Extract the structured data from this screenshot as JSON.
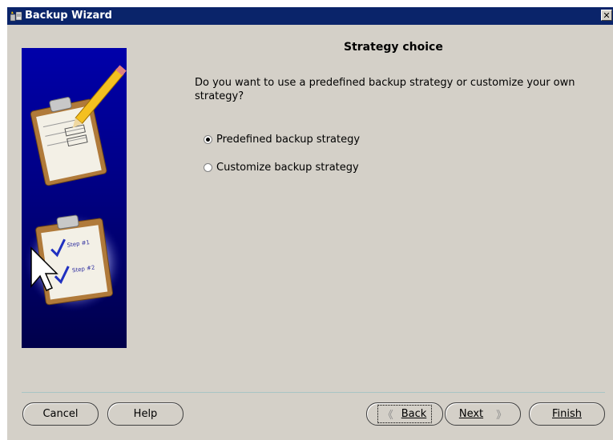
{
  "window": {
    "title": "Backup Wizard",
    "close_label": "✕"
  },
  "page": {
    "heading": "Strategy choice",
    "question": "Do you want to use a predefined backup strategy or customize your own strategy?"
  },
  "options": [
    {
      "label": "Predefined backup strategy",
      "selected": true
    },
    {
      "label": "Customize backup strategy",
      "selected": false
    }
  ],
  "buttons": {
    "cancel": "Cancel",
    "help": "Help",
    "back": "Back",
    "next": "Next",
    "finish": "Finish",
    "back_arrow": "《",
    "next_arrow": "》"
  },
  "colors": {
    "titlebar": "#0a246a",
    "window_bg": "#d4d0c8",
    "side_panel": "#00007a",
    "separator": "#a7c4c4"
  },
  "icons": {
    "title": "wizard-icon",
    "side": "clipboard-checklist-illustration"
  }
}
